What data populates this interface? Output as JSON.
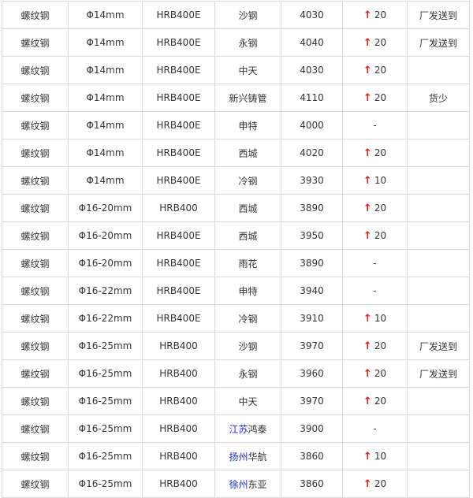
{
  "rows": [
    {
      "product": "螺纹钢",
      "spec": "Φ14mm",
      "grade": "HRB400E",
      "mill_link": "",
      "mill": "沙钢",
      "price": "4030",
      "change": "20",
      "up": true,
      "note": "厂发送到"
    },
    {
      "product": "螺纹钢",
      "spec": "Φ14mm",
      "grade": "HRB400E",
      "mill_link": "",
      "mill": "永钢",
      "price": "4040",
      "change": "20",
      "up": true,
      "note": "厂发送到"
    },
    {
      "product": "螺纹钢",
      "spec": "Φ14mm",
      "grade": "HRB400E",
      "mill_link": "",
      "mill": "中天",
      "price": "4030",
      "change": "20",
      "up": true,
      "note": ""
    },
    {
      "product": "螺纹钢",
      "spec": "Φ14mm",
      "grade": "HRB400E",
      "mill_link": "",
      "mill": "新兴铸管",
      "price": "4110",
      "change": "20",
      "up": true,
      "note": "货少"
    },
    {
      "product": "螺纹钢",
      "spec": "Φ14mm",
      "grade": "HRB400E",
      "mill_link": "",
      "mill": "申特",
      "price": "4000",
      "change": "-",
      "up": false,
      "note": ""
    },
    {
      "product": "螺纹钢",
      "spec": "Φ14mm",
      "grade": "HRB400E",
      "mill_link": "",
      "mill": "西城",
      "price": "4020",
      "change": "20",
      "up": true,
      "note": ""
    },
    {
      "product": "螺纹钢",
      "spec": "Φ14mm",
      "grade": "HRB400E",
      "mill_link": "",
      "mill": "冷钢",
      "price": "3930",
      "change": "10",
      "up": true,
      "note": ""
    },
    {
      "product": "螺纹钢",
      "spec": "Φ16-20mm",
      "grade": "HRB400",
      "mill_link": "",
      "mill": "西城",
      "price": "3890",
      "change": "20",
      "up": true,
      "note": ""
    },
    {
      "product": "螺纹钢",
      "spec": "Φ16-20mm",
      "grade": "HRB400E",
      "mill_link": "",
      "mill": "西城",
      "price": "3950",
      "change": "20",
      "up": true,
      "note": ""
    },
    {
      "product": "螺纹钢",
      "spec": "Φ16-20mm",
      "grade": "HRB400E",
      "mill_link": "",
      "mill": "雨花",
      "price": "3890",
      "change": "-",
      "up": false,
      "note": ""
    },
    {
      "product": "螺纹钢",
      "spec": "Φ16-22mm",
      "grade": "HRB400E",
      "mill_link": "",
      "mill": "申特",
      "price": "3940",
      "change": "-",
      "up": false,
      "note": ""
    },
    {
      "product": "螺纹钢",
      "spec": "Φ16-22mm",
      "grade": "HRB400E",
      "mill_link": "",
      "mill": "冷钢",
      "price": "3910",
      "change": "10",
      "up": true,
      "note": ""
    },
    {
      "product": "螺纹钢",
      "spec": "Φ16-25mm",
      "grade": "HRB400",
      "mill_link": "",
      "mill": "沙钢",
      "price": "3970",
      "change": "20",
      "up": true,
      "note": "厂发送到"
    },
    {
      "product": "螺纹钢",
      "spec": "Φ16-25mm",
      "grade": "HRB400",
      "mill_link": "",
      "mill": "永钢",
      "price": "3960",
      "change": "20",
      "up": true,
      "note": "厂发送到"
    },
    {
      "product": "螺纹钢",
      "spec": "Φ16-25mm",
      "grade": "HRB400",
      "mill_link": "",
      "mill": "中天",
      "price": "3970",
      "change": "20",
      "up": true,
      "note": ""
    },
    {
      "product": "螺纹钢",
      "spec": "Φ16-25mm",
      "grade": "HRB400",
      "mill_link": "江苏",
      "mill": "鸿泰",
      "price": "3900",
      "change": "-",
      "up": false,
      "note": ""
    },
    {
      "product": "螺纹钢",
      "spec": "Φ16-25mm",
      "grade": "HRB400",
      "mill_link": "扬州",
      "mill": "华航",
      "price": "3860",
      "change": "10",
      "up": true,
      "note": ""
    },
    {
      "product": "螺纹钢",
      "spec": "Φ16-25mm",
      "grade": "HRB400",
      "mill_link": "徐州",
      "mill": "东亚",
      "price": "3860",
      "change": "20",
      "up": true,
      "note": ""
    }
  ],
  "up_arrow_glyph": "↑",
  "colors": {
    "up_arrow": "#e11d1d",
    "link": "#1a2fd6",
    "border": "#d9d9d9",
    "text": "#333333"
  }
}
